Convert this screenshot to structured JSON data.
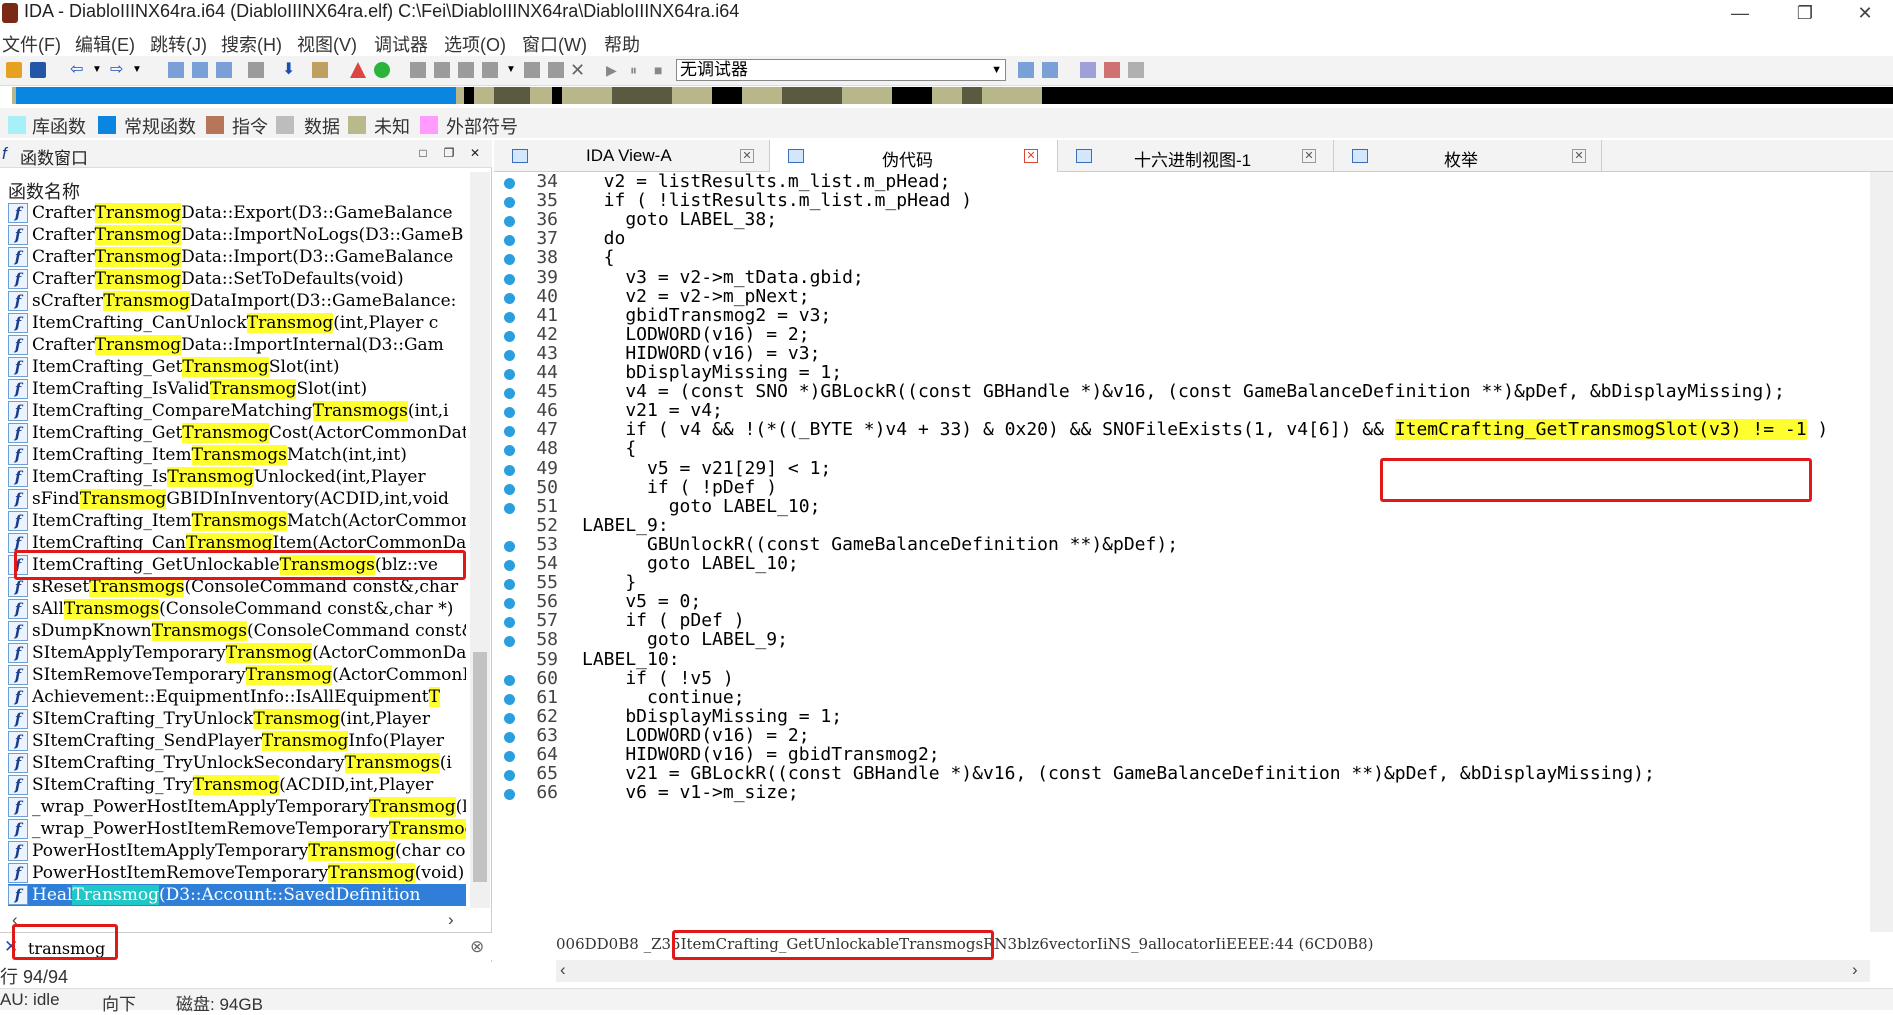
{
  "window": {
    "title": "IDA - DiabloIIINX64ra.i64 (DiabloIIINX64ra.elf) C:\\Fei\\DiabloIIINX64ra\\DiabloIIINX64ra.i64",
    "minimize": "—",
    "restore": "❐",
    "close": "✕"
  },
  "menu": [
    "文件(F)",
    "编辑(E)",
    "跳转(J)",
    "搜索(H)",
    "视图(V)",
    "调试器",
    "选项(O)",
    "窗口(W)",
    "帮助"
  ],
  "toolbar": {
    "debugger_select": "无调试器"
  },
  "legend": [
    {
      "label": "库函数",
      "color": "#a8f0f8"
    },
    {
      "label": "常规函数",
      "color": "#0b86e0"
    },
    {
      "label": "指令",
      "color": "#b5765a"
    },
    {
      "label": "数据",
      "color": "#bdbdbd"
    },
    {
      "label": "未知",
      "color": "#b9b98c"
    },
    {
      "label": "外部符号",
      "color": "#ff9aff"
    }
  ],
  "functions_panel": {
    "title": "函数窗口",
    "column_header": "函数名称",
    "icon_letter": "f",
    "rows": [
      {
        "pre": "Crafter",
        "hl": "Transmog",
        "post": "Data::Export(D3::GameBalance"
      },
      {
        "pre": "Crafter",
        "hl": "Transmog",
        "post": "Data::ImportNoLogs(D3::GameB"
      },
      {
        "pre": "Crafter",
        "hl": "Transmog",
        "post": "Data::Import(D3::GameBalance"
      },
      {
        "pre": "Crafter",
        "hl": "Transmog",
        "post": "Data::SetToDefaults(void)"
      },
      {
        "pre": "sCrafter",
        "hl": "Transmog",
        "post": "DataImport(D3::GameBalance:"
      },
      {
        "pre": "ItemCrafting_CanUnlock",
        "hl": "Transmog",
        "post": "(int,Player c"
      },
      {
        "pre": "Crafter",
        "hl": "Transmog",
        "post": "Data::ImportInternal(D3::Gam"
      },
      {
        "pre": "ItemCrafting_Get",
        "hl": "Transmog",
        "post": "Slot(int)"
      },
      {
        "pre": "ItemCrafting_IsValid",
        "hl": "Transmog",
        "post": "Slot(int)"
      },
      {
        "pre": "ItemCrafting_CompareMatching",
        "hl": "Transmogs",
        "post": "(int,i"
      },
      {
        "pre": "ItemCrafting_Get",
        "hl": "Transmog",
        "post": "Cost(ActorCommonDat"
      },
      {
        "pre": "ItemCrafting_Item",
        "hl": "Transmogs",
        "post": "Match(int,int)"
      },
      {
        "pre": "ItemCrafting_Is",
        "hl": "Transmog",
        "post": "Unlocked(int,Player"
      },
      {
        "pre": "sFind",
        "hl": "Transmog",
        "post": "GBIDInInventory(ACDID,int,void"
      },
      {
        "pre": "ItemCrafting_Item",
        "hl": "Transmogs",
        "post": "Match(ActorCommon"
      },
      {
        "pre": "ItemCrafting_Can",
        "hl": "Transmog",
        "post": "Item(ActorCommonDat"
      },
      {
        "pre": "ItemCrafting_GetUnlockable",
        "hl": "Transmogs",
        "post": "(blz::ve"
      },
      {
        "pre": "sReset",
        "hl": "Transmogs",
        "post": "(ConsoleCommand const&,char"
      },
      {
        "pre": "sAll",
        "hl": "Transmogs",
        "post": "(ConsoleCommand const&,char *)"
      },
      {
        "pre": "sDumpKnown",
        "hl": "Transmogs",
        "post": "(ConsoleCommand const&,c"
      },
      {
        "pre": "SItemApplyTemporary",
        "hl": "Transmog",
        "post": "(ActorCommonData"
      },
      {
        "pre": "SItemRemoveTemporary",
        "hl": "Transmog",
        "post": "(ActorCommonDat"
      },
      {
        "pre": "Achievement::EquipmentInfo::IsAllEquipment",
        "hl": "T",
        "post": ""
      },
      {
        "pre": "SItemCrafting_TryUnlock",
        "hl": "Transmog",
        "post": "(int,Player "
      },
      {
        "pre": "SItemCrafting_SendPlayer",
        "hl": "Transmog",
        "post": "Info(Player"
      },
      {
        "pre": "SItemCrafting_TryUnlockSecondary",
        "hl": "Transmogs",
        "post": "(i"
      },
      {
        "pre": "SItemCrafting_Try",
        "hl": "Transmog",
        "post": "(ACDID,int,Player "
      },
      {
        "pre": "_wrap_PowerHostItemApplyTemporary",
        "hl": "Transmog",
        "post": "(l"
      },
      {
        "pre": "_wrap_PowerHostItemRemoveTemporary",
        "hl": "Transmog",
        "post": "("
      },
      {
        "pre": "PowerHostItemApplyTemporary",
        "hl": "Transmog",
        "post": "(char co"
      },
      {
        "pre": "PowerHostItemRemoveTemporary",
        "hl": "Transmog",
        "post": "(void)"
      },
      {
        "pre": "Heal",
        "hl": "Transmog",
        "post": "(D3::Account::SavedDefinition"
      }
    ],
    "search_value": "transmog",
    "row_count": "行 94/94"
  },
  "tabs": [
    {
      "label": "IDA View-A"
    },
    {
      "label": "伪代码"
    },
    {
      "label": "十六进制视图-1"
    },
    {
      "label": "枚举"
    }
  ],
  "code": [
    {
      "n": "34",
      "t": "  v2 = listResults.m_list.m_pHead;"
    },
    {
      "n": "35",
      "t": "  if ( !listResults.m_list.m_pHead )"
    },
    {
      "n": "36",
      "t": "    goto LABEL_38;"
    },
    {
      "n": "37",
      "t": "  do"
    },
    {
      "n": "38",
      "t": "  {"
    },
    {
      "n": "39",
      "t": "    v3 = v2->m_tData.gbid;"
    },
    {
      "n": "40",
      "t": "    v2 = v2->m_pNext;"
    },
    {
      "n": "41",
      "t": "    gbidTransmog2 = v3;"
    },
    {
      "n": "42",
      "t": "    LODWORD(v16) = 2;"
    },
    {
      "n": "43",
      "t": "    HIDWORD(v16) = v3;"
    },
    {
      "n": "44",
      "t": "    bDisplayMissing = 1;"
    },
    {
      "n": "45",
      "t": "    v4 = (const SNO *)GBLockR((const GBHandle *)&v16, (const GameBalanceDefinition **)&pDef, &bDisplayMissing);"
    },
    {
      "n": "46",
      "t": "    v21 = v4;"
    },
    {
      "n": "47",
      "t": "    if ( v4 && !(*((_BYTE *)v4 + 33) & 0x20) && SNOFileExists(1, v4[6]) && ",
      "hl": "ItemCrafting_GetTransmogSlot(v3) != -1",
      "tail": " )"
    },
    {
      "n": "48",
      "t": "    {"
    },
    {
      "n": "49",
      "t": "      v5 = v21[29] < 1;"
    },
    {
      "n": "50",
      "t": "      if ( !pDef )"
    },
    {
      "n": "51",
      "t": "        goto LABEL_10;"
    },
    {
      "n": "52",
      "t": "LABEL_9:",
      "nodot": true
    },
    {
      "n": "53",
      "t": "      GBUnlockR((const GameBalanceDefinition **)&pDef);"
    },
    {
      "n": "54",
      "t": "      goto LABEL_10;"
    },
    {
      "n": "55",
      "t": "    }"
    },
    {
      "n": "56",
      "t": "    v5 = 0;"
    },
    {
      "n": "57",
      "t": "    if ( pDef )"
    },
    {
      "n": "58",
      "t": "      goto LABEL_9;"
    },
    {
      "n": "59",
      "t": "LABEL_10:",
      "nodot": true
    },
    {
      "n": "60",
      "t": "    if ( !v5 )"
    },
    {
      "n": "61",
      "t": "      continue;"
    },
    {
      "n": "62",
      "t": "    bDisplayMissing = 1;"
    },
    {
      "n": "63",
      "t": "    LODWORD(v16) = 2;"
    },
    {
      "n": "64",
      "t": "    HIDWORD(v16) = gbidTransmog2;"
    },
    {
      "n": "65",
      "t": "    v21 = GBLockR((const GBHandle *)&v16, (const GameBalanceDefinition **)&pDef, &bDisplayMissing);"
    },
    {
      "n": "66",
      "t": "    v6 = v1->m_size;"
    }
  ],
  "code_status": {
    "address": "006DD0B8",
    "prefix": "_Z35",
    "func": "ItemCrafting_GetUnlockableTransmogs",
    "suffix": "RN3blz6vectorIiNS_9allocatorIiEEEE:44 (6CD0B8)"
  },
  "status": {
    "au": "AU:  idle",
    "dir": "向下",
    "disk": "磁盘: 94GB"
  }
}
